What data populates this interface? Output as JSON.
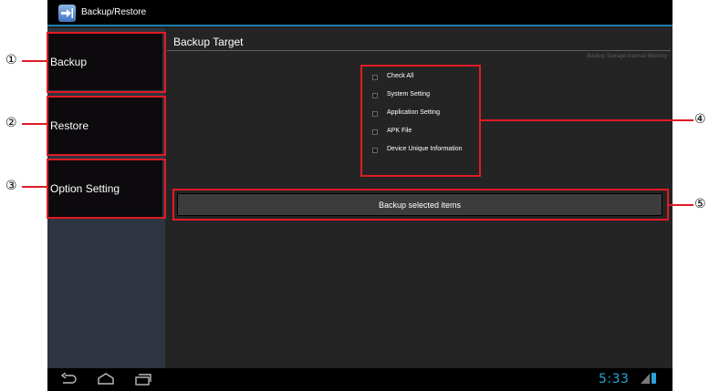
{
  "app": {
    "title": "Backup/Restore",
    "icon": "backup-restore-app-icon"
  },
  "sidebar": {
    "items": [
      {
        "label": "Backup"
      },
      {
        "label": "Restore"
      },
      {
        "label": "Option Setting"
      }
    ]
  },
  "main": {
    "title": "Backup Target",
    "storage_info": "Backup Storage:Internal Memory",
    "checkboxes": [
      {
        "label": "Check All",
        "checked": false
      },
      {
        "label": "System Setting",
        "checked": false
      },
      {
        "label": "Application Setting",
        "checked": false
      },
      {
        "label": "APK File",
        "checked": false
      },
      {
        "label": "Device Unique Information",
        "checked": false
      }
    ],
    "backup_button": "Backup selected items"
  },
  "system_bar": {
    "time": "5:33",
    "icons": [
      "back-icon",
      "home-icon",
      "recent-apps-icon",
      "signal-icon",
      "battery-icon"
    ]
  },
  "callouts": [
    "①",
    "②",
    "③",
    "④",
    "⑤"
  ],
  "colors": {
    "highlight": "#e01b24",
    "accent": "#2aa3d8",
    "button_bg": "#0c0a0d",
    "sidebar_bg": "#2e3540",
    "content_bg": "#242424"
  }
}
